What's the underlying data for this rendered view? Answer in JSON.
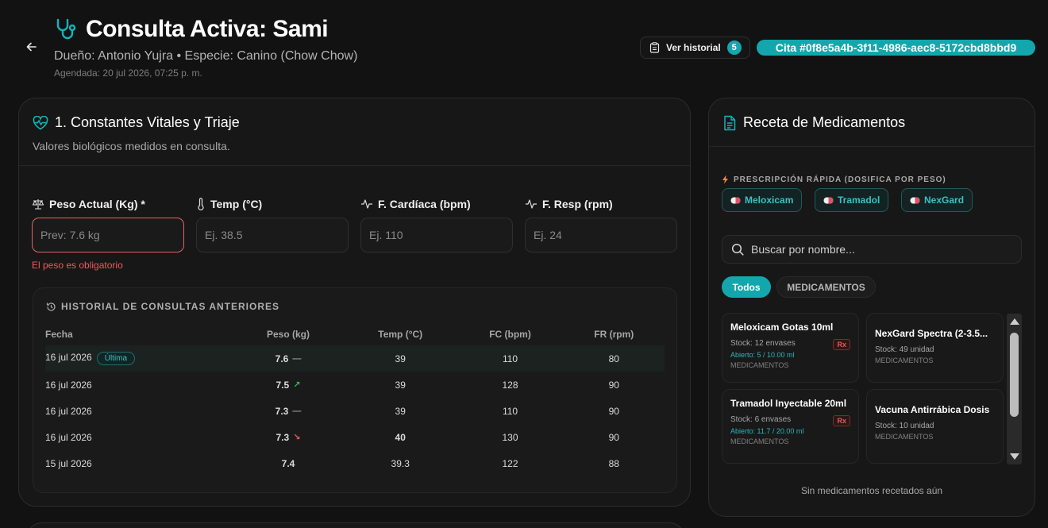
{
  "header": {
    "title": "Consulta Activa: Sami",
    "subtitle": "Dueño: Antonio Yujra • Especie: Canino (Chow Chow)",
    "scheduled": "Agendada: 20 jul 2026, 07:25 p. m.",
    "history_button": "Ver historial",
    "history_count": "5",
    "cita_badge": "Cita #0f8e5a4b-3f11-4986-aec8-5172cbd8bbd9"
  },
  "vitals": {
    "title": "1. Constantes Vitales y Triaje",
    "description": "Valores biológicos medidos en consulta.",
    "fields": [
      {
        "label": "Peso Actual (Kg) *",
        "placeholder": "Prev: 7.6 kg"
      },
      {
        "label": "Temp (°C)",
        "placeholder": "Ej. 38.5"
      },
      {
        "label": "F. Cardíaca (bpm)",
        "placeholder": "Ej. 110"
      },
      {
        "label": "F. Resp (rpm)",
        "placeholder": "Ej. 24"
      }
    ],
    "error": "El peso es obligatorio"
  },
  "history": {
    "title": "HISTORIAL DE CONSULTAS ANTERIORES",
    "columns": [
      "Fecha",
      "Peso (kg)",
      "Temp (°C)",
      "FC (bpm)",
      "FR (rpm)"
    ],
    "latest_badge": "Última",
    "rows": [
      {
        "date": "16 jul 2026",
        "peso": "7.6",
        "trend": "—",
        "temp": "39",
        "fc": "110",
        "fr": "80"
      },
      {
        "date": "16 jul 2026",
        "peso": "7.5",
        "trend": "↗",
        "temp": "39",
        "fc": "128",
        "fr": "90"
      },
      {
        "date": "16 jul 2026",
        "peso": "7.3",
        "trend": "—",
        "temp": "39",
        "fc": "110",
        "fr": "90"
      },
      {
        "date": "16 jul 2026",
        "peso": "7.3",
        "trend": "↘",
        "temp": "40",
        "fc": "130",
        "fr": "90"
      },
      {
        "date": "15 jul 2026",
        "peso": "7.4",
        "trend": "",
        "temp": "39.3",
        "fc": "122",
        "fr": "88"
      }
    ]
  },
  "prescription": {
    "title": "Receta de Medicamentos",
    "quick_title": "PRESCRIPCIÓN RÁPIDA (DOSIFICA POR PESO)",
    "quick_chips": [
      "Meloxicam",
      "Tramadol",
      "NexGard"
    ],
    "search_placeholder": "Buscar por nombre...",
    "tabs": [
      "Todos",
      "MEDICAMENTOS"
    ],
    "medications": [
      {
        "name": "Meloxicam Gotas 10ml",
        "stock": "Stock: 12 envases",
        "open": "Abierto: 5 / 10.00 ml",
        "category": "MEDICAMENTOS",
        "rx": "Rx"
      },
      {
        "name": "NexGard Spectra (2-3.5...",
        "stock": "Stock: 49 unidad",
        "open": "",
        "category": "MEDICAMENTOS",
        "rx": ""
      },
      {
        "name": "Tramadol Inyectable 20ml",
        "stock": "Stock: 6 envases",
        "open": "Abierto: 11.7 / 20.00 ml",
        "category": "MEDICAMENTOS",
        "rx": "Rx"
      },
      {
        "name": "Vacuna Antirrábica Dosis",
        "stock": "Stock: 10 unidad",
        "open": "",
        "category": "MEDICAMENTOS",
        "rx": ""
      }
    ],
    "empty_message": "Sin medicamentos recetados aún"
  },
  "colors": {
    "accent": "#13a7ad",
    "error": "#ef5a5a",
    "background": "#121212",
    "card": "#171717"
  }
}
